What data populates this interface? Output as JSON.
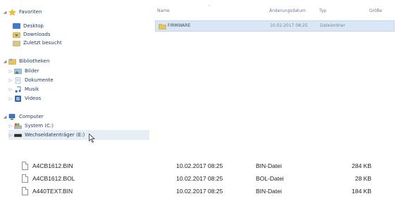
{
  "nav": {
    "favorites": {
      "label": "Favoriten",
      "items": [
        {
          "label": "Desktop"
        },
        {
          "label": "Downloads"
        },
        {
          "label": "Zuletzt besucht"
        }
      ]
    },
    "libraries": {
      "label": "Bibliotheken",
      "items": [
        {
          "label": "Bilder"
        },
        {
          "label": "Dokumente"
        },
        {
          "label": "Musik"
        },
        {
          "label": "Videos"
        }
      ]
    },
    "computer": {
      "label": "Computer",
      "items": [
        {
          "label": "System (C:)"
        },
        {
          "label": "Wechseldatenträger (E:)"
        }
      ]
    }
  },
  "list": {
    "columns": {
      "name": "Name",
      "date": "Änderungsdatum",
      "type": "Typ",
      "size": "Größe"
    },
    "rows": [
      {
        "name": "FIRMWARE",
        "date": "10.02.2017 08:25",
        "type": "Dateiordner",
        "size": ""
      }
    ]
  },
  "files": [
    {
      "name": "A4CB1612.BIN",
      "date": "10.02.2017 08:25",
      "type": "BIN-Datei",
      "size": "284 KB"
    },
    {
      "name": "A4CB1612.BOL",
      "date": "10.02.2017 08:25",
      "type": "BOL-Datei",
      "size": "28 KB"
    },
    {
      "name": "A440TEXT.BIN",
      "date": "10.02.2017 08:25",
      "type": "BIN-Datei",
      "size": "184 KB"
    }
  ],
  "colors": {
    "selection": "#d8e6f5",
    "folder": "#e8c35a",
    "star": "#f2c12e"
  }
}
